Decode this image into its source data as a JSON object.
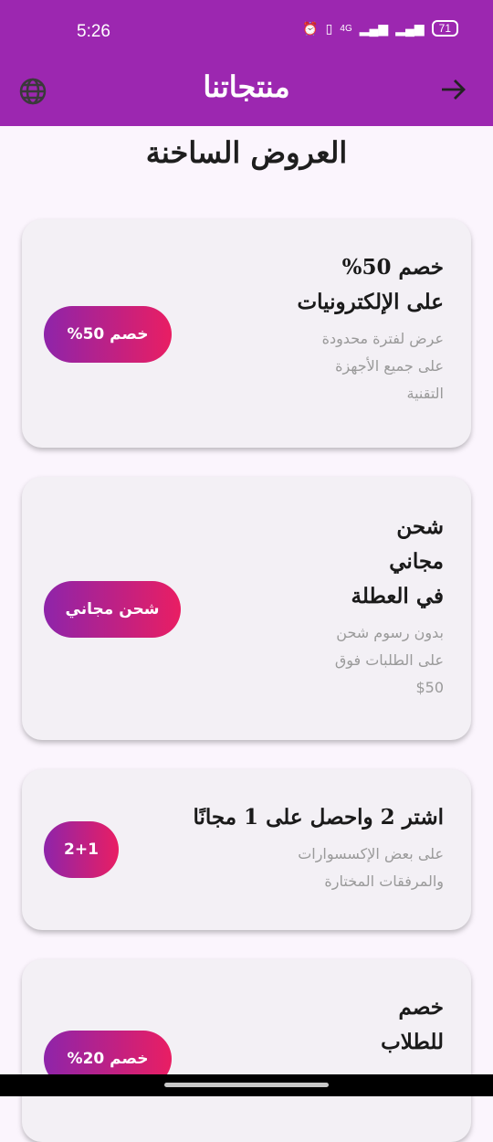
{
  "status": {
    "time": "5:26",
    "network": "4G",
    "battery": "71"
  },
  "appbar": {
    "title": "منتجاتنا"
  },
  "section_title": "العروض الساخنة",
  "offers": [
    {
      "title": "خصم 50%\nعلى الإلكترونيات",
      "subtitle": "عرض لفترة محدودة\nعلى جميع الأجهزة\nالتقنية",
      "badge": "خصم 50%"
    },
    {
      "title": "شحن\nمجاني\nفي العطلة",
      "subtitle": "بدون رسوم شحن\nعلى الطلبات فوق\n$50",
      "badge": "شحن مجاني"
    },
    {
      "title": "اشتر 2 واحصل على 1 مجانًا",
      "subtitle": "على بعض الإكسسوارات\nوالمرفقات المختارة",
      "badge": "2+1"
    },
    {
      "title": "خصم\nللطلاب",
      "subtitle": "",
      "badge": "خصم 20%"
    }
  ]
}
